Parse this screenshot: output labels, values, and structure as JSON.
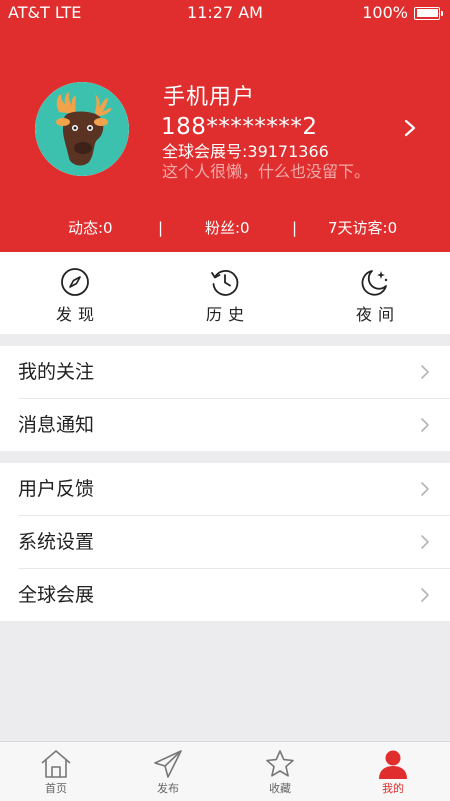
{
  "status_bar": {
    "carrier": "AT&T  LTE",
    "time": "11:27 AM",
    "battery": "100%"
  },
  "profile": {
    "name": "手机用户",
    "phone": "188********2",
    "id_text": "全球会展号:39171366",
    "bio": "这个人很懒，什么也没留下。"
  },
  "stats": {
    "posts": "动态:0",
    "fans": "粉丝:0",
    "visitors": "7天访客:0",
    "divider": "|"
  },
  "quick_actions": [
    {
      "label": "发现",
      "icon": "compass-icon"
    },
    {
      "label": "历史",
      "icon": "history-icon"
    },
    {
      "label": "夜间",
      "icon": "moon-icon"
    }
  ],
  "menu_group_1": [
    {
      "label": "我的关注"
    },
    {
      "label": "消息通知"
    }
  ],
  "menu_group_2": [
    {
      "label": "用户反馈"
    },
    {
      "label": "系统设置"
    },
    {
      "label": "全球会展"
    }
  ],
  "tabs": [
    {
      "label": "首页",
      "icon": "home-icon",
      "active": false
    },
    {
      "label": "发布",
      "icon": "send-icon",
      "active": false
    },
    {
      "label": "收藏",
      "icon": "star-icon",
      "active": false
    },
    {
      "label": "我的",
      "icon": "user-icon",
      "active": true
    }
  ],
  "colors": {
    "brand_red": "#e02e2e",
    "bio_text": "#f2a9a9",
    "background": "#ececee"
  }
}
